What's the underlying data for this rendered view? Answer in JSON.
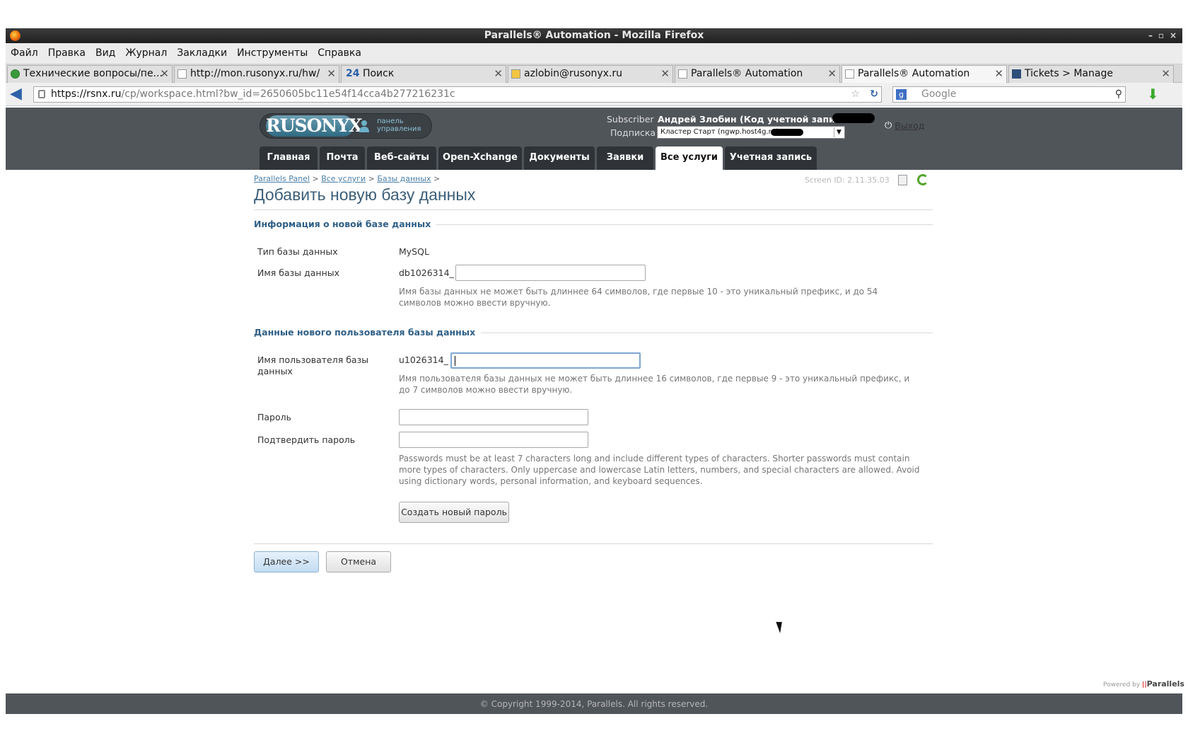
{
  "window": {
    "title": "Parallels® Automation - Mozilla Firefox",
    "controls": [
      "–",
      "▫",
      "×"
    ]
  },
  "menubar": [
    "Файл",
    "Правка",
    "Вид",
    "Журнал",
    "Закладки",
    "Инструменты",
    "Справка"
  ],
  "tabs": [
    {
      "label": "Технические вопросы/пе...",
      "active": false
    },
    {
      "label": "http://mon.rusonyx.ru/hw/",
      "active": false
    },
    {
      "label": "Поиск",
      "active": false,
      "prefix": "24"
    },
    {
      "label": "azlobin@rusonyx.ru",
      "active": false
    },
    {
      "label": "Parallels® Automation",
      "active": false
    },
    {
      "label": "Parallels® Automation",
      "active": true
    },
    {
      "label": "Tickets > Manage",
      "active": false
    }
  ],
  "address": {
    "url_domain": "https://rsnx.ru",
    "url_path": "/cp/workspace.html?bw_id=2650605bc11e54f14cca4b277216231c"
  },
  "search": {
    "placeholder": "Google",
    "engine_glyph": "g"
  },
  "header": {
    "logo_text": "RUSONYX",
    "logo_sub": [
      "панель",
      "управления"
    ],
    "subscriber_label": "Subscriber",
    "subscriber_value": "Андрей Злобин (Код учетной записи:",
    "subscription_label": "Подписка",
    "subscription_value": "Кластер Старт (ngwp.host4g.ru)",
    "logout": "Выход"
  },
  "nav_tabs": [
    "Главная",
    "Почта",
    "Веб-сайты",
    "Open-Xchange",
    "Документы",
    "Заявки",
    "Все услуги",
    "Учетная запись"
  ],
  "breadcrumb": [
    "Parallels Panel",
    "Все услуги",
    "Базы данных"
  ],
  "screen_id": "Screen ID: 2.11.35.03",
  "page_title": "Добавить новую базу данных",
  "section1": {
    "title": "Информация о новой базе данных",
    "db_type_label": "Тип базы данных",
    "db_type_value": "MySQL",
    "db_name_label": "Имя базы данных",
    "db_name_prefix": "db1026314_",
    "db_name_value": "",
    "db_name_hint": "Имя базы данных не может быть длиннее 64 символов, где первые 10 - это уникальный префикс, и до 54 символов можно ввести вручную."
  },
  "section2": {
    "title": "Данные нового пользователя базы данных",
    "user_label": "Имя пользователя базы данных",
    "user_prefix": "u1026314_",
    "user_value": "",
    "user_hint": "Имя пользователя базы данных не может быть длиннее 16 символов, где первые 9 - это уникальный префикс, и до 7 символов можно ввести вручную.",
    "password_label": "Пароль",
    "confirm_label": "Подтвердить пароль",
    "password_hint": "Passwords must be at least 7 characters long and include different types of characters. Shorter passwords must contain more types of characters. Only uppercase and lowercase Latin letters, numbers, and special characters are allowed. Avoid using dictionary words, personal information, and keyboard sequences.",
    "generate_button": "Создать новый пароль"
  },
  "actions": {
    "next": "Далее >>",
    "cancel": "Отмена"
  },
  "footer": {
    "powered_by": "Powered by",
    "brand": "Parallels",
    "copyright": "© Copyright 1999-2014, Parallels. All rights reserved."
  },
  "colors": {
    "header_bg": "#50555a",
    "nav_tab_bg": "#2f3337",
    "title_blue": "#3c5e79",
    "section_blue": "#2f5f86",
    "link_blue": "#4a7fa8"
  },
  "icons": [
    "firefox-logo-icon",
    "back-arrow-icon",
    "lock-icon",
    "star-icon",
    "reload-icon",
    "binoculars-icon",
    "download-icon",
    "user-icon",
    "power-icon",
    "page-icon",
    "refresh-icon",
    "cursor-icon"
  ]
}
